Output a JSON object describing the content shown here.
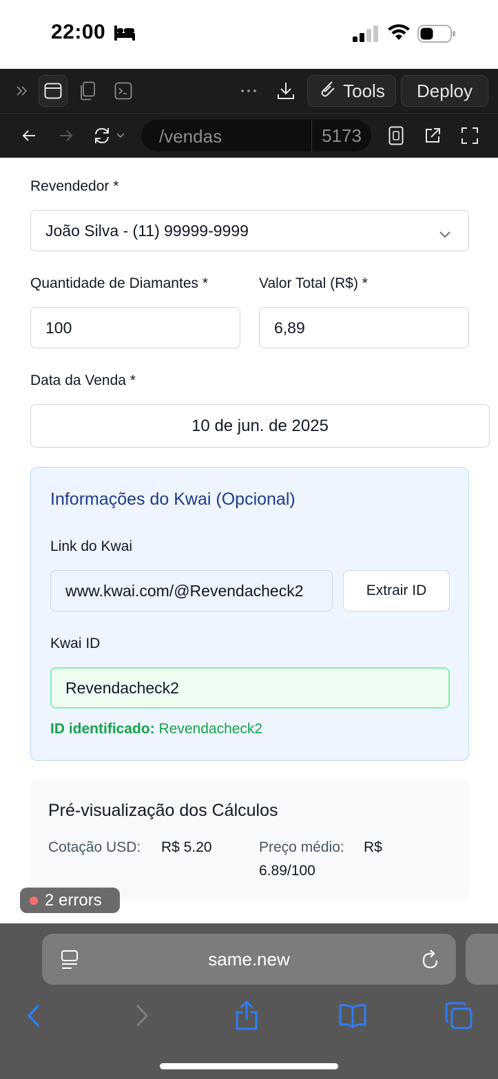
{
  "status_bar": {
    "time": "22:00"
  },
  "ide_toolbar": {
    "tools_label": "Tools",
    "deploy_label": "Deploy"
  },
  "ide_nav": {
    "url_path": "/vendas",
    "port": "5173"
  },
  "form": {
    "reseller_label": "Revendedor *",
    "reseller_value": "João Silva - (11) 99999-9999",
    "quantity_label": "Quantidade de Diamantes *",
    "quantity_value": "100",
    "total_label": "Valor Total (R$) *",
    "total_value": "6,89",
    "date_label": "Data da Venda *",
    "date_value": "10 de jun. de 2025"
  },
  "kwai": {
    "title": "Informações do Kwai (Opcional)",
    "link_label": "Link do Kwai",
    "link_value": "www.kwai.com/@Revendacheck2",
    "extract_button": "Extrair ID",
    "id_label": "Kwai ID",
    "id_value": "Revendacheck2",
    "identified_prefix": "ID identificado:",
    "identified_value": "Revendacheck2"
  },
  "preview": {
    "title": "Pré-visualização dos Cálculos",
    "usd_label": "Cotação USD:",
    "usd_value": "R$ 5.20",
    "avg_label": "Preço médio:",
    "avg_value_line1": "R$",
    "avg_value_line2": "6.89/100"
  },
  "errors_badge": {
    "label": "2 errors"
  },
  "safari": {
    "url": "same.new"
  },
  "colors": {
    "accent_blue": "#1e3a8a",
    "success_green": "#16a34a",
    "ide_bg": "#1c1c1c",
    "safari_bg": "#575757",
    "ios_blue": "#2f7cf6"
  }
}
